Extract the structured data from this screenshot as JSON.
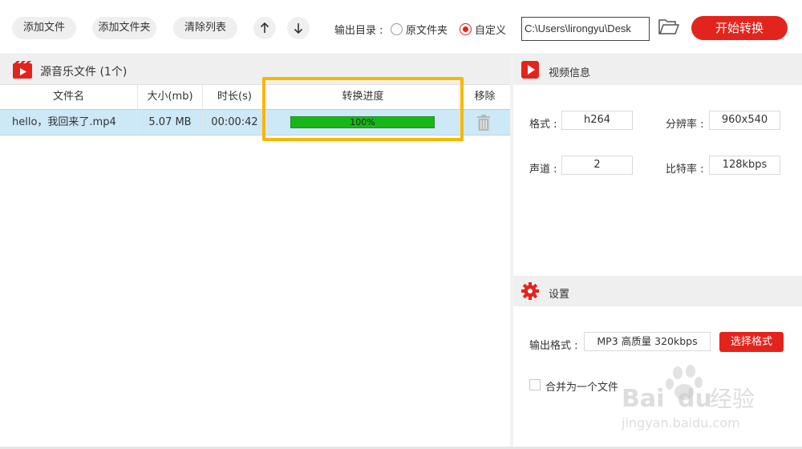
{
  "toolbar": {
    "add_file": "添加文件",
    "add_folder": "添加文件夹",
    "clear_list": "清除列表",
    "output_dir_label": "输出目录 :",
    "radio_original": "原文件夹",
    "radio_custom": "自定义",
    "output_path": "C:\\Users\\lirongyu\\Desk",
    "start_button": "开始转换"
  },
  "file_list": {
    "title": "源音乐文件 (1个)",
    "columns": [
      "文件名",
      "大小(mb)",
      "时长(s)",
      "转换进度",
      "移除"
    ],
    "rows": [
      {
        "name": "hello，我回来了.mp4",
        "size": "5.07 MB",
        "duration": "00:00:42",
        "progress": 1.0,
        "progress_text": "100%"
      }
    ]
  },
  "video_info": {
    "title": "视频信息",
    "format_label": "格式 :",
    "format_value": "h264",
    "resolution_label": "分辨率 :",
    "resolution_value": "960x540",
    "channels_label": "声道 :",
    "channels_value": "2",
    "bitrate_label": "比特率 :",
    "bitrate_value": "128kbps"
  },
  "settings": {
    "title": "设置",
    "output_format_label": "输出格式 :",
    "output_format_value": "MP3 高质量 320kbps",
    "choose_format": "选择格式",
    "merge_label": "合并为一个文件"
  },
  "watermark": {
    "brand": "Bai",
    "brand2": "du",
    "brand_cn": "经验",
    "url": "jingyan.baidu.com"
  },
  "colors": {
    "accent_red": "#e3241c",
    "progress_green": "#18b718",
    "selected_row": "#cde8f6",
    "highlight": "#f5b800"
  },
  "icons": [
    "arrow-up-icon",
    "arrow-down-icon",
    "folder-open-icon",
    "music-file-icon",
    "trash-icon",
    "video-icon",
    "gear-icon"
  ]
}
